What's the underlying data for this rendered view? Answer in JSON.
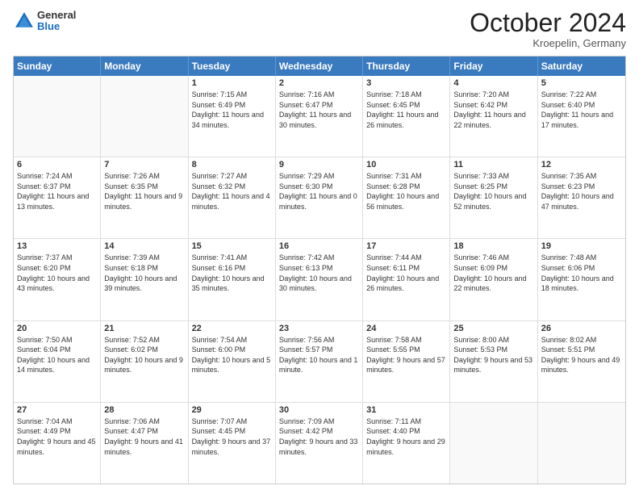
{
  "header": {
    "logo_general": "General",
    "logo_blue": "Blue",
    "month_title": "October 2024",
    "location": "Kroepelin, Germany"
  },
  "calendar": {
    "days_of_week": [
      "Sunday",
      "Monday",
      "Tuesday",
      "Wednesday",
      "Thursday",
      "Friday",
      "Saturday"
    ],
    "rows": [
      [
        {
          "day": "",
          "sunrise": "",
          "sunset": "",
          "daylight": ""
        },
        {
          "day": "",
          "sunrise": "",
          "sunset": "",
          "daylight": ""
        },
        {
          "day": "1",
          "sunrise": "Sunrise: 7:15 AM",
          "sunset": "Sunset: 6:49 PM",
          "daylight": "Daylight: 11 hours and 34 minutes."
        },
        {
          "day": "2",
          "sunrise": "Sunrise: 7:16 AM",
          "sunset": "Sunset: 6:47 PM",
          "daylight": "Daylight: 11 hours and 30 minutes."
        },
        {
          "day": "3",
          "sunrise": "Sunrise: 7:18 AM",
          "sunset": "Sunset: 6:45 PM",
          "daylight": "Daylight: 11 hours and 26 minutes."
        },
        {
          "day": "4",
          "sunrise": "Sunrise: 7:20 AM",
          "sunset": "Sunset: 6:42 PM",
          "daylight": "Daylight: 11 hours and 22 minutes."
        },
        {
          "day": "5",
          "sunrise": "Sunrise: 7:22 AM",
          "sunset": "Sunset: 6:40 PM",
          "daylight": "Daylight: 11 hours and 17 minutes."
        }
      ],
      [
        {
          "day": "6",
          "sunrise": "Sunrise: 7:24 AM",
          "sunset": "Sunset: 6:37 PM",
          "daylight": "Daylight: 11 hours and 13 minutes."
        },
        {
          "day": "7",
          "sunrise": "Sunrise: 7:26 AM",
          "sunset": "Sunset: 6:35 PM",
          "daylight": "Daylight: 11 hours and 9 minutes."
        },
        {
          "day": "8",
          "sunrise": "Sunrise: 7:27 AM",
          "sunset": "Sunset: 6:32 PM",
          "daylight": "Daylight: 11 hours and 4 minutes."
        },
        {
          "day": "9",
          "sunrise": "Sunrise: 7:29 AM",
          "sunset": "Sunset: 6:30 PM",
          "daylight": "Daylight: 11 hours and 0 minutes."
        },
        {
          "day": "10",
          "sunrise": "Sunrise: 7:31 AM",
          "sunset": "Sunset: 6:28 PM",
          "daylight": "Daylight: 10 hours and 56 minutes."
        },
        {
          "day": "11",
          "sunrise": "Sunrise: 7:33 AM",
          "sunset": "Sunset: 6:25 PM",
          "daylight": "Daylight: 10 hours and 52 minutes."
        },
        {
          "day": "12",
          "sunrise": "Sunrise: 7:35 AM",
          "sunset": "Sunset: 6:23 PM",
          "daylight": "Daylight: 10 hours and 47 minutes."
        }
      ],
      [
        {
          "day": "13",
          "sunrise": "Sunrise: 7:37 AM",
          "sunset": "Sunset: 6:20 PM",
          "daylight": "Daylight: 10 hours and 43 minutes."
        },
        {
          "day": "14",
          "sunrise": "Sunrise: 7:39 AM",
          "sunset": "Sunset: 6:18 PM",
          "daylight": "Daylight: 10 hours and 39 minutes."
        },
        {
          "day": "15",
          "sunrise": "Sunrise: 7:41 AM",
          "sunset": "Sunset: 6:16 PM",
          "daylight": "Daylight: 10 hours and 35 minutes."
        },
        {
          "day": "16",
          "sunrise": "Sunrise: 7:42 AM",
          "sunset": "Sunset: 6:13 PM",
          "daylight": "Daylight: 10 hours and 30 minutes."
        },
        {
          "day": "17",
          "sunrise": "Sunrise: 7:44 AM",
          "sunset": "Sunset: 6:11 PM",
          "daylight": "Daylight: 10 hours and 26 minutes."
        },
        {
          "day": "18",
          "sunrise": "Sunrise: 7:46 AM",
          "sunset": "Sunset: 6:09 PM",
          "daylight": "Daylight: 10 hours and 22 minutes."
        },
        {
          "day": "19",
          "sunrise": "Sunrise: 7:48 AM",
          "sunset": "Sunset: 6:06 PM",
          "daylight": "Daylight: 10 hours and 18 minutes."
        }
      ],
      [
        {
          "day": "20",
          "sunrise": "Sunrise: 7:50 AM",
          "sunset": "Sunset: 6:04 PM",
          "daylight": "Daylight: 10 hours and 14 minutes."
        },
        {
          "day": "21",
          "sunrise": "Sunrise: 7:52 AM",
          "sunset": "Sunset: 6:02 PM",
          "daylight": "Daylight: 10 hours and 9 minutes."
        },
        {
          "day": "22",
          "sunrise": "Sunrise: 7:54 AM",
          "sunset": "Sunset: 6:00 PM",
          "daylight": "Daylight: 10 hours and 5 minutes."
        },
        {
          "day": "23",
          "sunrise": "Sunrise: 7:56 AM",
          "sunset": "Sunset: 5:57 PM",
          "daylight": "Daylight: 10 hours and 1 minute."
        },
        {
          "day": "24",
          "sunrise": "Sunrise: 7:58 AM",
          "sunset": "Sunset: 5:55 PM",
          "daylight": "Daylight: 9 hours and 57 minutes."
        },
        {
          "day": "25",
          "sunrise": "Sunrise: 8:00 AM",
          "sunset": "Sunset: 5:53 PM",
          "daylight": "Daylight: 9 hours and 53 minutes."
        },
        {
          "day": "26",
          "sunrise": "Sunrise: 8:02 AM",
          "sunset": "Sunset: 5:51 PM",
          "daylight": "Daylight: 9 hours and 49 minutes."
        }
      ],
      [
        {
          "day": "27",
          "sunrise": "Sunrise: 7:04 AM",
          "sunset": "Sunset: 4:49 PM",
          "daylight": "Daylight: 9 hours and 45 minutes."
        },
        {
          "day": "28",
          "sunrise": "Sunrise: 7:06 AM",
          "sunset": "Sunset: 4:47 PM",
          "daylight": "Daylight: 9 hours and 41 minutes."
        },
        {
          "day": "29",
          "sunrise": "Sunrise: 7:07 AM",
          "sunset": "Sunset: 4:45 PM",
          "daylight": "Daylight: 9 hours and 37 minutes."
        },
        {
          "day": "30",
          "sunrise": "Sunrise: 7:09 AM",
          "sunset": "Sunset: 4:42 PM",
          "daylight": "Daylight: 9 hours and 33 minutes."
        },
        {
          "day": "31",
          "sunrise": "Sunrise: 7:11 AM",
          "sunset": "Sunset: 4:40 PM",
          "daylight": "Daylight: 9 hours and 29 minutes."
        },
        {
          "day": "",
          "sunrise": "",
          "sunset": "",
          "daylight": ""
        },
        {
          "day": "",
          "sunrise": "",
          "sunset": "",
          "daylight": ""
        }
      ]
    ]
  }
}
